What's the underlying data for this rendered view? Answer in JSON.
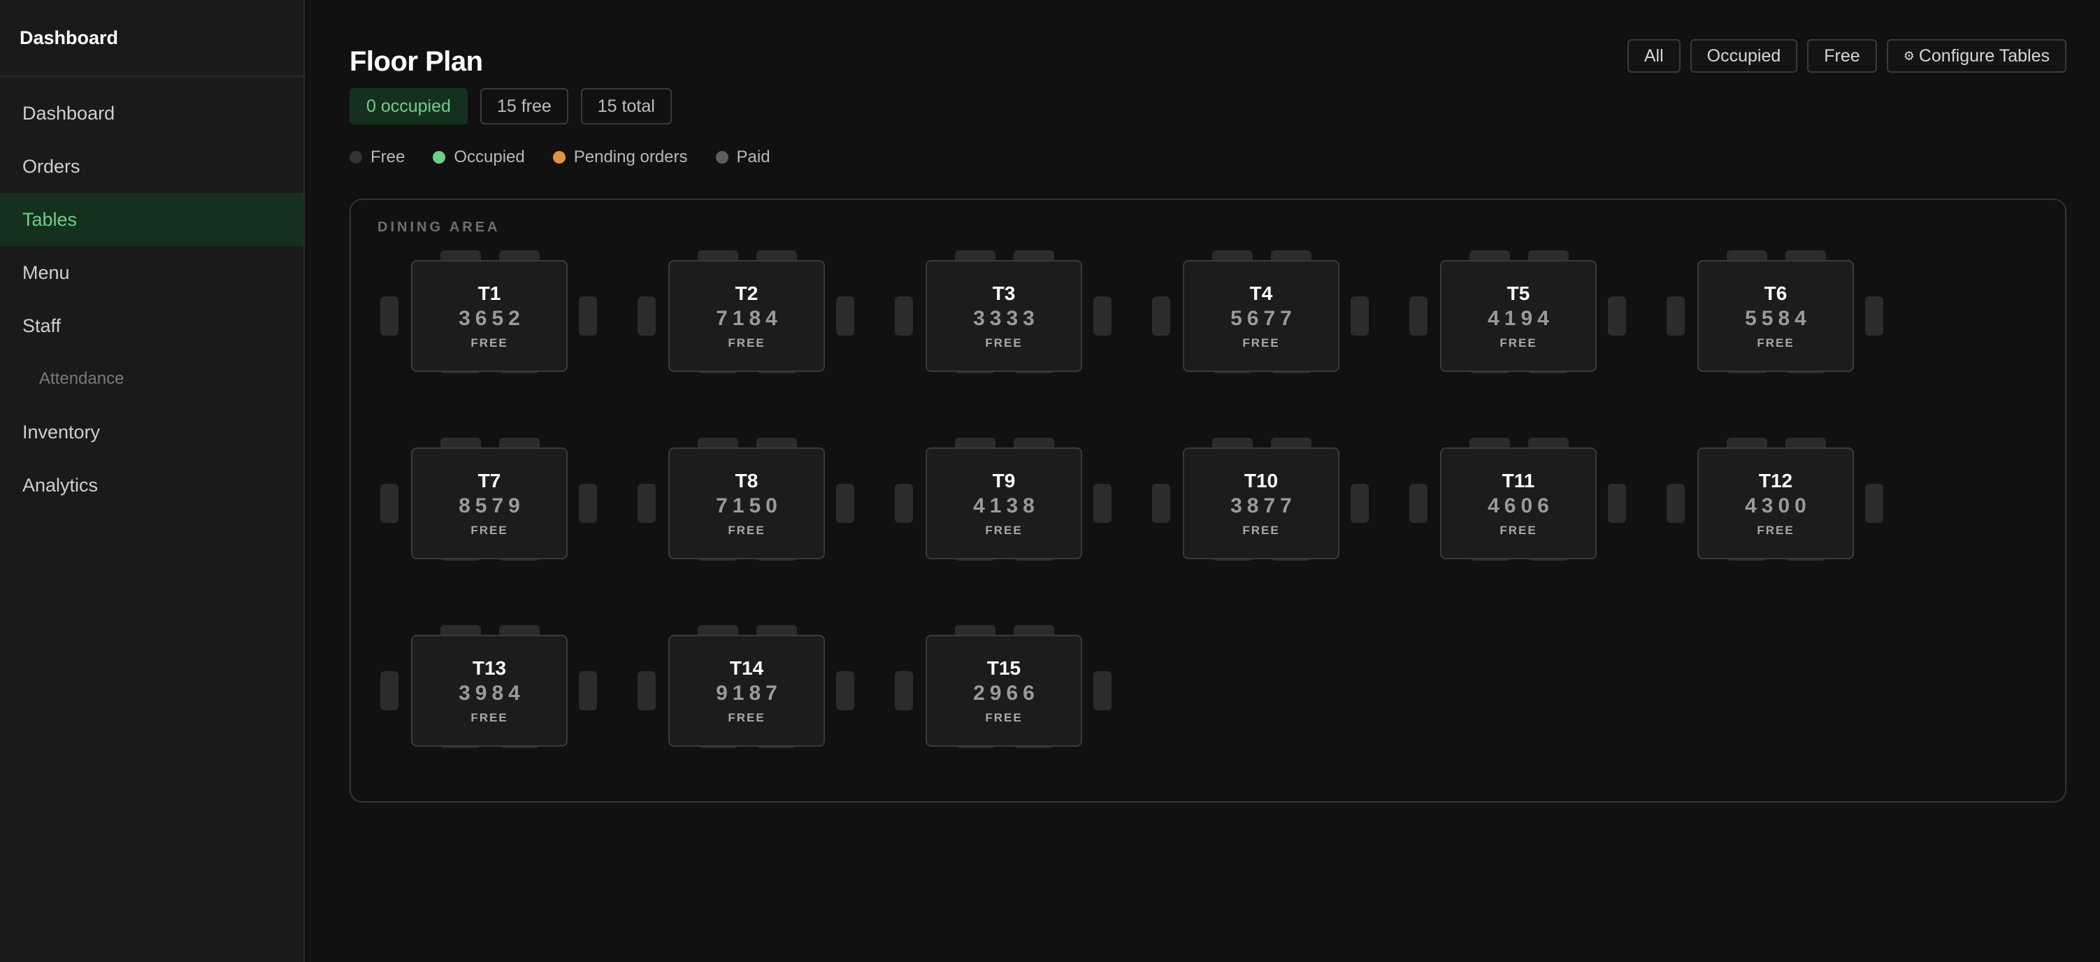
{
  "sidebar": {
    "brand": "Dashboard",
    "items": [
      {
        "label": "Dashboard"
      },
      {
        "label": "Orders"
      },
      {
        "label": "Tables"
      },
      {
        "label": "Menu"
      },
      {
        "label": "Staff"
      },
      {
        "label": "Attendance"
      },
      {
        "label": "Inventory"
      },
      {
        "label": "Analytics"
      }
    ]
  },
  "header": {
    "title": "Floor Plan",
    "stats": {
      "occupied": "0 occupied",
      "free": "15 free",
      "total": "15 total"
    }
  },
  "legend": [
    {
      "label": "Free",
      "color": "#333333"
    },
    {
      "label": "Occupied",
      "color": "#6fcf8a"
    },
    {
      "label": "Pending orders",
      "color": "#e0953c"
    },
    {
      "label": "Paid",
      "color": "#5e5e5e"
    }
  ],
  "filters": {
    "all": "All",
    "occupied": "Occupied",
    "free": "Free",
    "configure_icon": "⚙",
    "configure": "Configure Tables"
  },
  "area": {
    "label": "DINING AREA",
    "tables": [
      {
        "name": "T1",
        "code": "3652",
        "status": "FREE"
      },
      {
        "name": "T2",
        "code": "7184",
        "status": "FREE"
      },
      {
        "name": "T3",
        "code": "3333",
        "status": "FREE"
      },
      {
        "name": "T4",
        "code": "5677",
        "status": "FREE"
      },
      {
        "name": "T5",
        "code": "4194",
        "status": "FREE"
      },
      {
        "name": "T6",
        "code": "5584",
        "status": "FREE"
      },
      {
        "name": "T7",
        "code": "8579",
        "status": "FREE"
      },
      {
        "name": "T8",
        "code": "7150",
        "status": "FREE"
      },
      {
        "name": "T9",
        "code": "4138",
        "status": "FREE"
      },
      {
        "name": "T10",
        "code": "3877",
        "status": "FREE"
      },
      {
        "name": "T11",
        "code": "4606",
        "status": "FREE"
      },
      {
        "name": "T12",
        "code": "4300",
        "status": "FREE"
      },
      {
        "name": "T13",
        "code": "3984",
        "status": "FREE"
      },
      {
        "name": "T14",
        "code": "9187",
        "status": "FREE"
      },
      {
        "name": "T15",
        "code": "2966",
        "status": "FREE"
      }
    ]
  }
}
